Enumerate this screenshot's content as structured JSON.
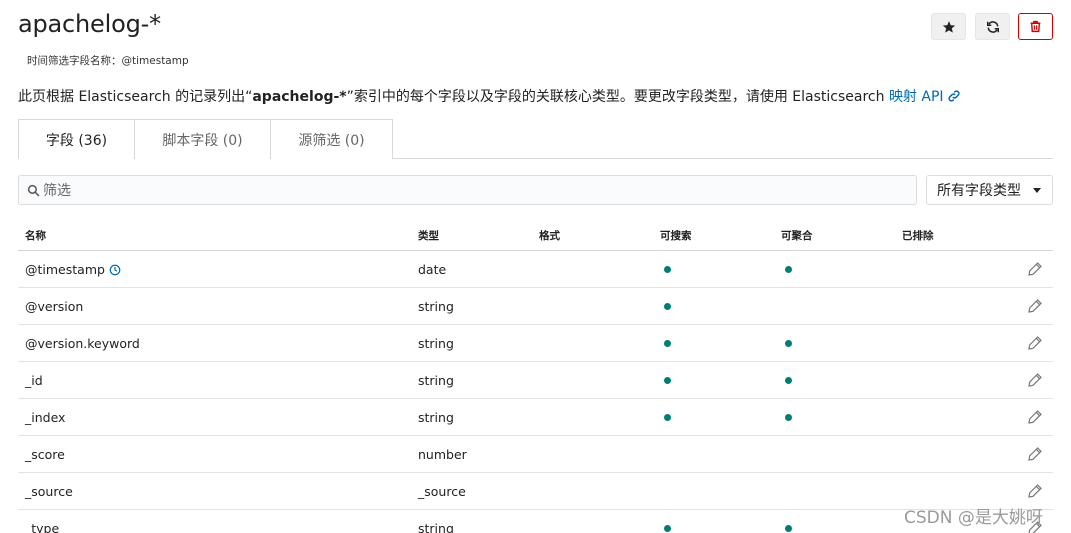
{
  "header": {
    "title": "apachelog-*",
    "subtitle": "时间筛选字段名称：@timestamp",
    "buttons": {
      "star_icon": "star-icon",
      "refresh_icon": "refresh-icon",
      "delete_icon": "trash-icon"
    }
  },
  "description": {
    "before": "此页根据 Elasticsearch 的记录列出“",
    "index": "apachelog-*",
    "after": "”索引中的每个字段以及字段的关联核心类型。要更改字段类型，请使用 Elasticsearch ",
    "link": "映射 API"
  },
  "tabs": [
    {
      "label": "字段 (36)",
      "active": true
    },
    {
      "label": "脚本字段 (0)",
      "active": false
    },
    {
      "label": "源筛选 (0)",
      "active": false
    }
  ],
  "filter": {
    "placeholder": "筛选",
    "type_select": "所有字段类型"
  },
  "table": {
    "columns": [
      "名称",
      "类型",
      "格式",
      "可搜索",
      "可聚合",
      "已排除"
    ],
    "rows": [
      {
        "name": "@timestamp",
        "type": "date",
        "format": "",
        "searchable": true,
        "aggregatable": true,
        "excluded": false,
        "time_field": true
      },
      {
        "name": "@version",
        "type": "string",
        "format": "",
        "searchable": true,
        "aggregatable": false,
        "excluded": false
      },
      {
        "name": "@version.keyword",
        "type": "string",
        "format": "",
        "searchable": true,
        "aggregatable": true,
        "excluded": false
      },
      {
        "name": "_id",
        "type": "string",
        "format": "",
        "searchable": true,
        "aggregatable": true,
        "excluded": false
      },
      {
        "name": "_index",
        "type": "string",
        "format": "",
        "searchable": true,
        "aggregatable": true,
        "excluded": false
      },
      {
        "name": "_score",
        "type": "number",
        "format": "",
        "searchable": false,
        "aggregatable": false,
        "excluded": false
      },
      {
        "name": "_source",
        "type": "_source",
        "format": "",
        "searchable": false,
        "aggregatable": false,
        "excluded": false
      },
      {
        "name": "_type",
        "type": "string",
        "format": "",
        "searchable": true,
        "aggregatable": true,
        "excluded": false
      }
    ]
  },
  "colors": {
    "accent": "#006bb4",
    "dot": "#017d73",
    "danger": "#cc0000"
  },
  "watermark": "CSDN @是大姚呀"
}
